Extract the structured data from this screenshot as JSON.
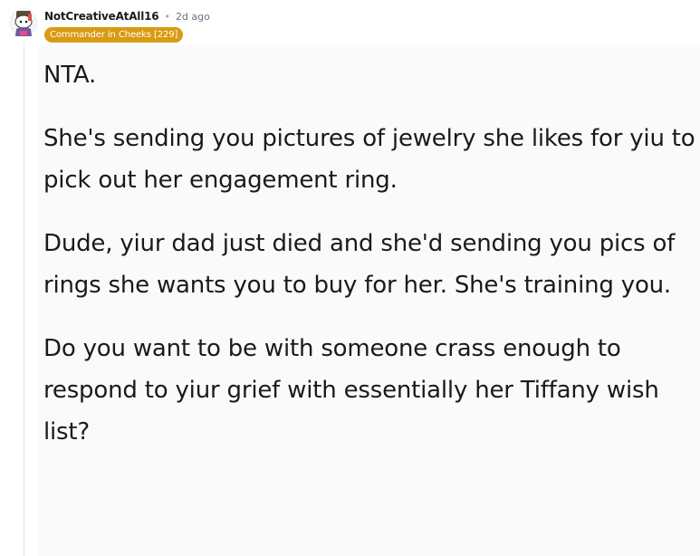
{
  "comment": {
    "author": "NotCreativeAtAll16",
    "separator": "•",
    "timestamp": "2d ago",
    "flair": "Commander in Cheeks [229]",
    "flair_color": "#d89b12",
    "avatar_icon": "snoo-avatar-icon",
    "paragraphs": [
      "NTA.",
      "She's sending you pictures of jewelry she likes for yiu to pick out her engagement ring.",
      "Dude, yiur dad just died and she'd sending you pics of rings she wants you to buy for her. She's training you.",
      "Do you want to be with someone crass enough to respond to yiur grief with essentially her Tiffany wish list?"
    ]
  }
}
